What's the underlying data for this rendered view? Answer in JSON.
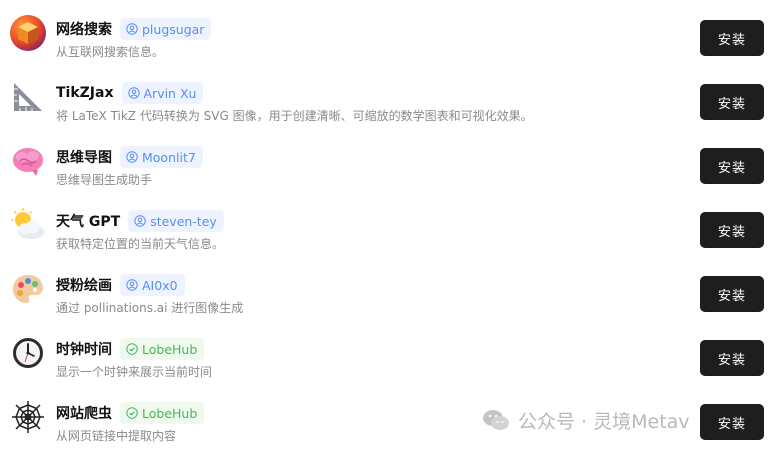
{
  "install_label": "安装",
  "plugins": [
    {
      "title": "网络搜索",
      "author": "plugsugar",
      "author_type": "user",
      "description": "从互联网搜索信息。",
      "icon": "orange-cube-icon"
    },
    {
      "title": "TikZJax",
      "author": "Arvin Xu",
      "author_type": "user",
      "description": "将 LaTeX TikZ 代码转换为 SVG 图像，用于创建清晰、可缩放的数学图表和可视化效果。",
      "icon": "triangle-ruler-icon"
    },
    {
      "title": "思维导图",
      "author": "Moonlit7",
      "author_type": "user",
      "description": "思维导图生成助手",
      "icon": "brain-icon"
    },
    {
      "title": "天气 GPT",
      "author": "steven-tey",
      "author_type": "user",
      "description": "获取特定位置的当前天气信息。",
      "icon": "sun-cloud-icon"
    },
    {
      "title": "授粉绘画",
      "author": "AI0x0",
      "author_type": "user",
      "description": "通过 pollinations.ai 进行图像生成",
      "icon": "palette-icon"
    },
    {
      "title": "时钟时间",
      "author": "LobeHub",
      "author_type": "official",
      "description": "显示一个时钟来展示当前时间",
      "icon": "clock-icon"
    },
    {
      "title": "网站爬虫",
      "author": "LobeHub",
      "author_type": "official",
      "description": "从网页链接中提取内容",
      "icon": "spider-web-icon"
    }
  ],
  "watermark": {
    "text": "公众号 · 灵境Metav",
    "icon": "wechat-icon"
  },
  "colors": {
    "button_bg": "#1e1e1e",
    "user_badge_text": "#5b8def",
    "official_badge_text": "#4bb35a"
  }
}
